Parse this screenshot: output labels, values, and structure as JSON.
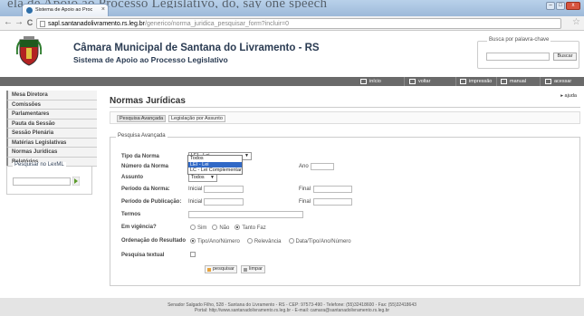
{
  "browser": {
    "caption_text": "ela de Apoio ao Processo Legislativo, do, say one speech",
    "tab_title": "Sistema de Apoio ao Proc",
    "tab_close": "×",
    "window_buttons": [
      "–",
      "□",
      "x"
    ],
    "url_host": "sapl.santanadolivramento.rs.leg.br",
    "url_path": "/generico/norma_juridica_pesquisar_form?incluir=0",
    "back": "←",
    "forward": "→",
    "reload": "C",
    "star": "☆"
  },
  "header": {
    "title": "Câmara Municipal de Santana do Livramento - RS",
    "subtitle": "Sistema de Apoio ao Processo Legislativo",
    "search_legend": "Busca por palavra-chave",
    "search_button": "Buscar"
  },
  "menu": [
    {
      "label": "início",
      "icon": "home-icon"
    },
    {
      "label": "voltar",
      "icon": "back-icon"
    },
    {
      "label": "impressão",
      "icon": "print-icon"
    },
    {
      "label": "manual",
      "icon": "manual-icon"
    },
    {
      "label": "acessar",
      "icon": "user-icon"
    }
  ],
  "sidebar": {
    "items": [
      {
        "label": "Mesa Diretora"
      },
      {
        "label": "Comissões"
      },
      {
        "label": "Parlamentares"
      },
      {
        "label": "Pauta da Sessão"
      },
      {
        "label": "Sessão Plenária"
      },
      {
        "label": "Matérias Legislativas"
      },
      {
        "label": "Normas Jurídicas"
      },
      {
        "label": "Relatórios"
      }
    ],
    "lexml_legend": "Pesquisar no LexML"
  },
  "main": {
    "title": "Normas Jurídicas",
    "help": "ajuda",
    "tabs": [
      {
        "label": "Pesquisa Avançada"
      },
      {
        "label": "Legislação por Assunto"
      }
    ],
    "fieldset_legend": "Pesquisa Avançada",
    "labels": {
      "tipo": "Tipo da Norma",
      "numero": "Número da Norma",
      "ano": "Ano",
      "assunto": "Assunto",
      "periodo_norma": "Período da Norma:",
      "periodo_publicacao": "Período de Publicação:",
      "inicial": "Inicial",
      "final": "Final",
      "termos": "Termos",
      "vigencia": "Em vigência?",
      "ordenacao": "Ordenação do Resultado",
      "textual": "Pesquisa textual"
    },
    "tipo_selected": "LEI - Lei",
    "tipo_options": [
      "Todos",
      "LEI - Lei",
      "LC - Lei Complementar"
    ],
    "tipo_highlighted_index": 1,
    "assunto_selected": "Todos",
    "vigencia_options": [
      {
        "label": "Sim",
        "checked": false
      },
      {
        "label": "Não",
        "checked": false
      },
      {
        "label": "Tanto Faz",
        "checked": true
      }
    ],
    "ordenacao_options": [
      {
        "label": "Tipo/Ano/Número",
        "checked": true
      },
      {
        "label": "Relevância",
        "checked": false
      },
      {
        "label": "Data/Tipo/Ano/Número",
        "checked": false
      }
    ],
    "buttons": {
      "pesquisar": "pesquisar",
      "limpar": "limpar"
    }
  },
  "footer": {
    "line1": "Senador Salgado Filho, 528 - Santana do Livramento - RS - CEP: 97573-490 - Telefone: (55)32418600 - Fax: (55)32418643",
    "line2": "Portal: http://www.santanadolivramento.rs.leg.br - E-mail: camara@santanadolivramento.rs.leg.br"
  },
  "colors": {
    "menubar": "#6a6a6a",
    "title_text": "#2a3b52",
    "dropdown_highlight": "#3169c6"
  }
}
